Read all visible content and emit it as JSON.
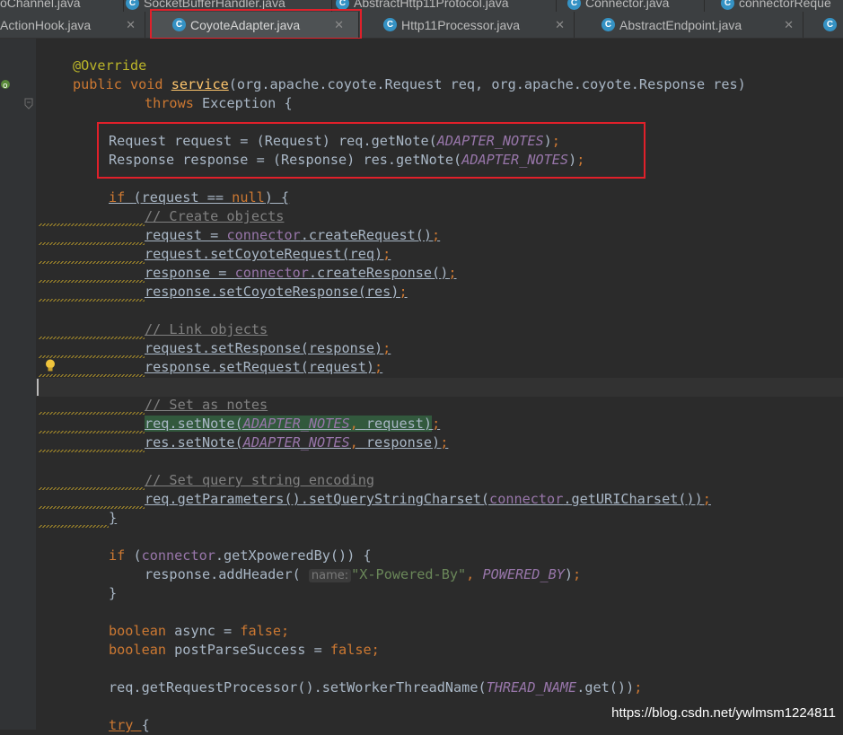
{
  "tabs_top": [
    {
      "label": "oChannel.java"
    },
    {
      "label": "SocketBufferHandler.java"
    },
    {
      "label": "AbstractHttp11Protocol.java"
    },
    {
      "label": "Connector.java"
    },
    {
      "label": "connectorReque"
    }
  ],
  "tabs": [
    {
      "label": "ActionHook.java"
    },
    {
      "label": "CoyoteAdapter.java"
    },
    {
      "label": "Http11Processor.java"
    },
    {
      "label": "AbstractEndpoint.java"
    }
  ],
  "editor": {
    "param_hint": "name:",
    "string_literal": "\"X-Powered-By\"",
    "comments": [
      "// Create objects",
      "// Link objects",
      "// Set as notes",
      "// Set query string encoding"
    ]
  },
  "watermark": "https://blog.csdn.net/ywlmsm1224811",
  "colors": {
    "keyword": "#cc7832",
    "annotation": "#bbb529",
    "constant": "#9876aa",
    "string": "#6a8759",
    "highlight_box": "#e0202a"
  }
}
